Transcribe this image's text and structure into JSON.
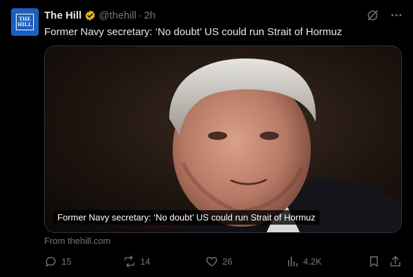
{
  "post": {
    "author": {
      "name": "The Hill",
      "handle": "@thehill",
      "separator": "·",
      "time": "2h",
      "avatar_text": "THE HILL"
    },
    "text": "Former Navy secretary: ‘No doubt’ US could run Strait of Hormuz",
    "card": {
      "title": "Former Navy secretary: ‘No doubt’ US could run Strait of Hormuz",
      "source": "From thehill.com"
    },
    "stats": {
      "replies": "15",
      "reposts": "14",
      "likes": "26",
      "views": "4.2K"
    }
  },
  "colors": {
    "background": "#000000",
    "text": "#e7e9ea",
    "muted": "#71767b",
    "verified": "#e2b719",
    "avatar": "#1d5fbf"
  },
  "icons": [
    "grok-icon",
    "more-icon",
    "verified-badge-icon",
    "reply-icon",
    "repost-icon",
    "like-icon",
    "views-icon",
    "bookmark-icon",
    "share-icon"
  ]
}
